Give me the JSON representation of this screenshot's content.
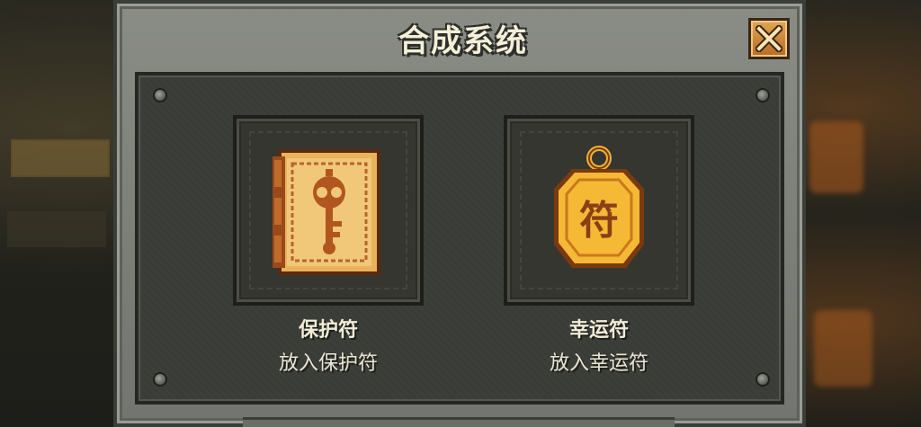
{
  "dialog": {
    "title": "合成系统",
    "close_icon": "close-icon"
  },
  "slots": [
    {
      "name": "保护符",
      "action": "放入保护符",
      "icon": "protection-book-icon",
      "colors": {
        "gold": "#e9b45c",
        "brown": "#8a3f16"
      }
    },
    {
      "name": "幸运符",
      "action": "放入幸运符",
      "icon": "luck-charm-icon",
      "glyph": "符",
      "colors": {
        "gold": "#f0b233",
        "brown": "#8a3f16"
      }
    }
  ]
}
